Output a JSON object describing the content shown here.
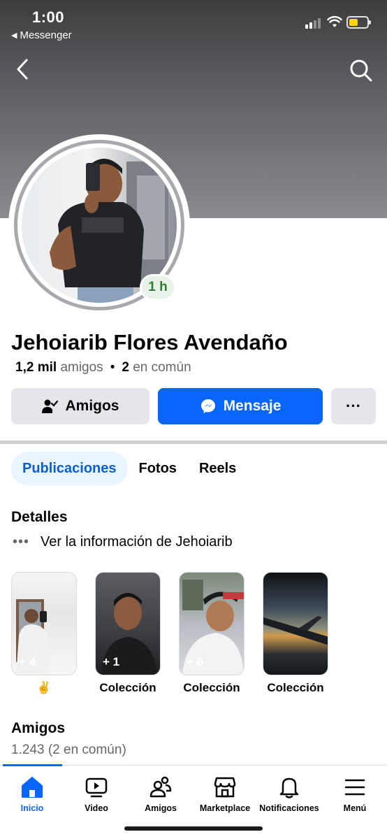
{
  "status_bar": {
    "time": "1:00",
    "back_app": "Messenger"
  },
  "profile": {
    "name": "Jehoiarib Flores Avendaño",
    "story_time": "1 h",
    "friends_count": "1,2 mil",
    "friends_label": "amigos",
    "mutual_count": "2",
    "mutual_label": "en común"
  },
  "actions": {
    "friends": "Amigos",
    "message": "Mensaje",
    "more": "···"
  },
  "tabs": [
    {
      "label": "Publicaciones",
      "active": true
    },
    {
      "label": "Fotos",
      "active": false
    },
    {
      "label": "Reels",
      "active": false
    }
  ],
  "details": {
    "title": "Detalles",
    "info": "Ver la información de Jehoiarib"
  },
  "featured": [
    {
      "count": "+ 4",
      "label": "✌️"
    },
    {
      "count": "+ 1",
      "label": "Colección"
    },
    {
      "count": "+ 6",
      "label": "Colección"
    },
    {
      "count": "",
      "label": "Colección"
    }
  ],
  "friends_section": {
    "title": "Amigos",
    "subtitle": "1.243 (2 en común)"
  },
  "bottom_nav": [
    {
      "label": "Inicio",
      "icon": "home-icon",
      "active": true
    },
    {
      "label": "Video",
      "icon": "video-icon",
      "active": false
    },
    {
      "label": "Amigos",
      "icon": "friends-icon",
      "active": false
    },
    {
      "label": "Marketplace",
      "icon": "marketplace-icon",
      "active": false
    },
    {
      "label": "Notificaciones",
      "icon": "bell-icon",
      "active": false
    },
    {
      "label": "Menú",
      "icon": "menu-icon",
      "active": false
    }
  ],
  "colors": {
    "accent": "#0866ff",
    "story_badge": "#2e7d32"
  }
}
